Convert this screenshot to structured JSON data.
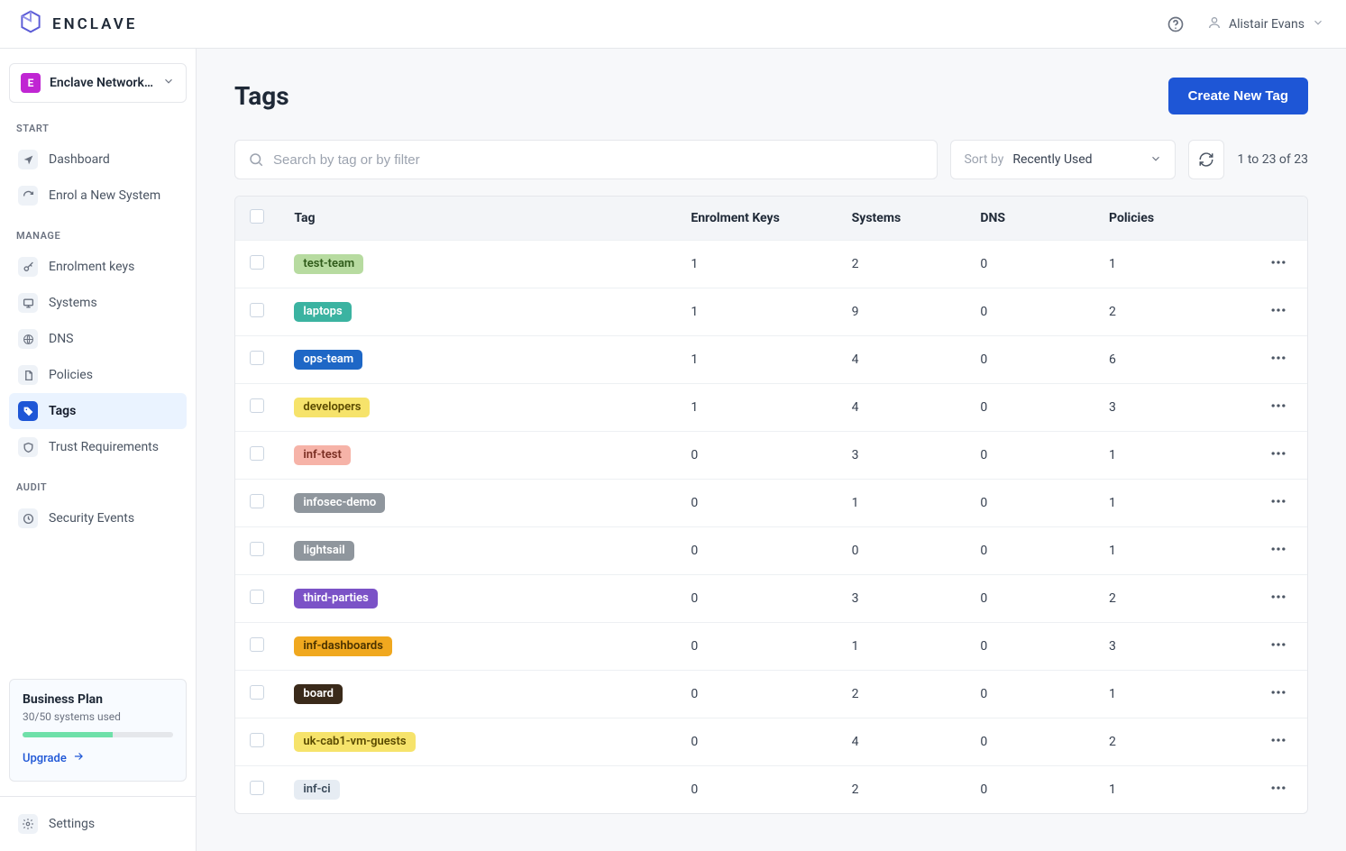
{
  "brand": {
    "name": "ENCLAVE"
  },
  "header": {
    "user_name": "Alistair Evans"
  },
  "org": {
    "initial": "E",
    "name": "Enclave Networks …"
  },
  "sidebar": {
    "groups": [
      {
        "label": "START",
        "items": [
          {
            "id": "dashboard",
            "label": "Dashboard",
            "icon": "nav-arrow"
          },
          {
            "id": "enrol",
            "label": "Enrol a New System",
            "icon": "refresh"
          }
        ]
      },
      {
        "label": "MANAGE",
        "items": [
          {
            "id": "enrolment-keys",
            "label": "Enrolment keys",
            "icon": "key"
          },
          {
            "id": "systems",
            "label": "Systems",
            "icon": "monitor"
          },
          {
            "id": "dns",
            "label": "DNS",
            "icon": "globe"
          },
          {
            "id": "policies",
            "label": "Policies",
            "icon": "doc"
          },
          {
            "id": "tags",
            "label": "Tags",
            "icon": "tag",
            "active": true
          },
          {
            "id": "trust",
            "label": "Trust Requirements",
            "icon": "shield"
          }
        ]
      },
      {
        "label": "AUDIT",
        "items": [
          {
            "id": "security-events",
            "label": "Security Events",
            "icon": "clock"
          }
        ]
      }
    ],
    "settings_label": "Settings"
  },
  "plan": {
    "title": "Business Plan",
    "usage": "30/50 systems used",
    "progress_pct": 60,
    "upgrade_label": "Upgrade"
  },
  "page": {
    "title": "Tags",
    "cta": "Create New Tag",
    "search_placeholder": "Search by tag or by filter",
    "sort_label": "Sort by",
    "sort_value": "Recently Used",
    "range": "1 to 23 of 23",
    "columns": {
      "tag": "Tag",
      "keys": "Enrolment Keys",
      "systems": "Systems",
      "dns": "DNS",
      "policies": "Policies"
    },
    "rows": [
      {
        "name": "test-team",
        "keys": 1,
        "systems": 2,
        "dns": 0,
        "policies": 1,
        "bg": "#b7dba0",
        "fg": "#2e5a19"
      },
      {
        "name": "laptops",
        "keys": 1,
        "systems": 9,
        "dns": 0,
        "policies": 2,
        "bg": "#3bb3a1",
        "fg": "#ffffff"
      },
      {
        "name": "ops-team",
        "keys": 1,
        "systems": 4,
        "dns": 0,
        "policies": 6,
        "bg": "#1e67c6",
        "fg": "#ffffff"
      },
      {
        "name": "developers",
        "keys": 1,
        "systems": 4,
        "dns": 0,
        "policies": 3,
        "bg": "#f6e36b",
        "fg": "#5a4a00"
      },
      {
        "name": "inf-test",
        "keys": 0,
        "systems": 3,
        "dns": 0,
        "policies": 1,
        "bg": "#f6b3a8",
        "fg": "#7a2e22"
      },
      {
        "name": "infosec-demo",
        "keys": 0,
        "systems": 1,
        "dns": 0,
        "policies": 1,
        "bg": "#8f969d",
        "fg": "#ffffff"
      },
      {
        "name": "lightsail",
        "keys": 0,
        "systems": 0,
        "dns": 0,
        "policies": 1,
        "bg": "#8f969d",
        "fg": "#ffffff"
      },
      {
        "name": "third-parties",
        "keys": 0,
        "systems": 3,
        "dns": 0,
        "policies": 2,
        "bg": "#7b52c7",
        "fg": "#ffffff"
      },
      {
        "name": "inf-dashboards",
        "keys": 0,
        "systems": 1,
        "dns": 0,
        "policies": 3,
        "bg": "#f0a81f",
        "fg": "#4a3200"
      },
      {
        "name": "board",
        "keys": 0,
        "systems": 2,
        "dns": 0,
        "policies": 1,
        "bg": "#3a2a1a",
        "fg": "#ffffff"
      },
      {
        "name": "uk-cab1-vm-guests",
        "keys": 0,
        "systems": 4,
        "dns": 0,
        "policies": 2,
        "bg": "#f6e36b",
        "fg": "#5a4a00"
      },
      {
        "name": "inf-ci",
        "keys": 0,
        "systems": 2,
        "dns": 0,
        "policies": 1,
        "bg": "#e6ecf3",
        "fg": "#3a4a5a"
      }
    ]
  }
}
